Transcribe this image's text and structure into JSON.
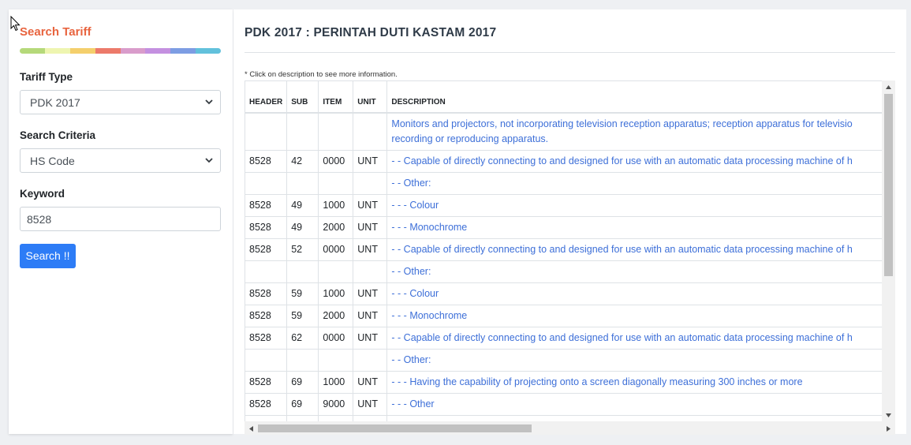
{
  "sidebar": {
    "title": "Search Tariff",
    "strip_colors": [
      "#b5d97a",
      "#eef5b0",
      "#f4cf6c",
      "#ec7a6a",
      "#d99ccb",
      "#c490e0",
      "#7d9de3",
      "#62c1dc"
    ],
    "tariff_type_label": "Tariff Type",
    "tariff_type_value": "PDK 2017",
    "criteria_label": "Search Criteria",
    "criteria_value": "HS Code",
    "keyword_label": "Keyword",
    "keyword_value": "8528",
    "search_button": "Search !!"
  },
  "main": {
    "title": "PDK 2017 : PERINTAH DUTI KASTAM 2017",
    "hint": "* Click on description to see more information.",
    "columns": [
      "HEADER",
      "SUB",
      "ITEM",
      "UNIT",
      "DESCRIPTION"
    ],
    "rows": [
      {
        "header": "",
        "sub": "",
        "item": "",
        "unit": "",
        "desc": "Monitors and projectors, not incorporating television reception apparatus; reception apparatus for televisio recording or reproducing apparatus."
      },
      {
        "header": "8528",
        "sub": "42",
        "item": "0000",
        "unit": "UNT",
        "desc": "- - Capable of directly connecting to and designed for use with an automatic data processing machine of h"
      },
      {
        "header": "",
        "sub": "",
        "item": "",
        "unit": "",
        "desc": "- - Other:"
      },
      {
        "header": "8528",
        "sub": "49",
        "item": "1000",
        "unit": "UNT",
        "desc": "- - - Colour"
      },
      {
        "header": "8528",
        "sub": "49",
        "item": "2000",
        "unit": "UNT",
        "desc": "- - - Monochrome"
      },
      {
        "header": "8528",
        "sub": "52",
        "item": "0000",
        "unit": "UNT",
        "desc": "- - Capable of directly connecting to and designed for use with an automatic data processing machine of h"
      },
      {
        "header": "",
        "sub": "",
        "item": "",
        "unit": "",
        "desc": "- - Other:"
      },
      {
        "header": "8528",
        "sub": "59",
        "item": "1000",
        "unit": "UNT",
        "desc": "- - - Colour"
      },
      {
        "header": "8528",
        "sub": "59",
        "item": "2000",
        "unit": "UNT",
        "desc": "- - - Monochrome"
      },
      {
        "header": "8528",
        "sub": "62",
        "item": "0000",
        "unit": "UNT",
        "desc": "- - Capable of directly connecting to and designed for use with an automatic data processing machine of h"
      },
      {
        "header": "",
        "sub": "",
        "item": "",
        "unit": "",
        "desc": "- - Other:"
      },
      {
        "header": "8528",
        "sub": "69",
        "item": "1000",
        "unit": "UNT",
        "desc": "- - - Having the capability of projecting onto a screen diagonally measuring 300 inches or more"
      },
      {
        "header": "8528",
        "sub": "69",
        "item": "9000",
        "unit": "UNT",
        "desc": "- - - Other"
      },
      {
        "header": "",
        "sub": "",
        "item": "",
        "unit": "",
        "desc": ""
      }
    ]
  }
}
